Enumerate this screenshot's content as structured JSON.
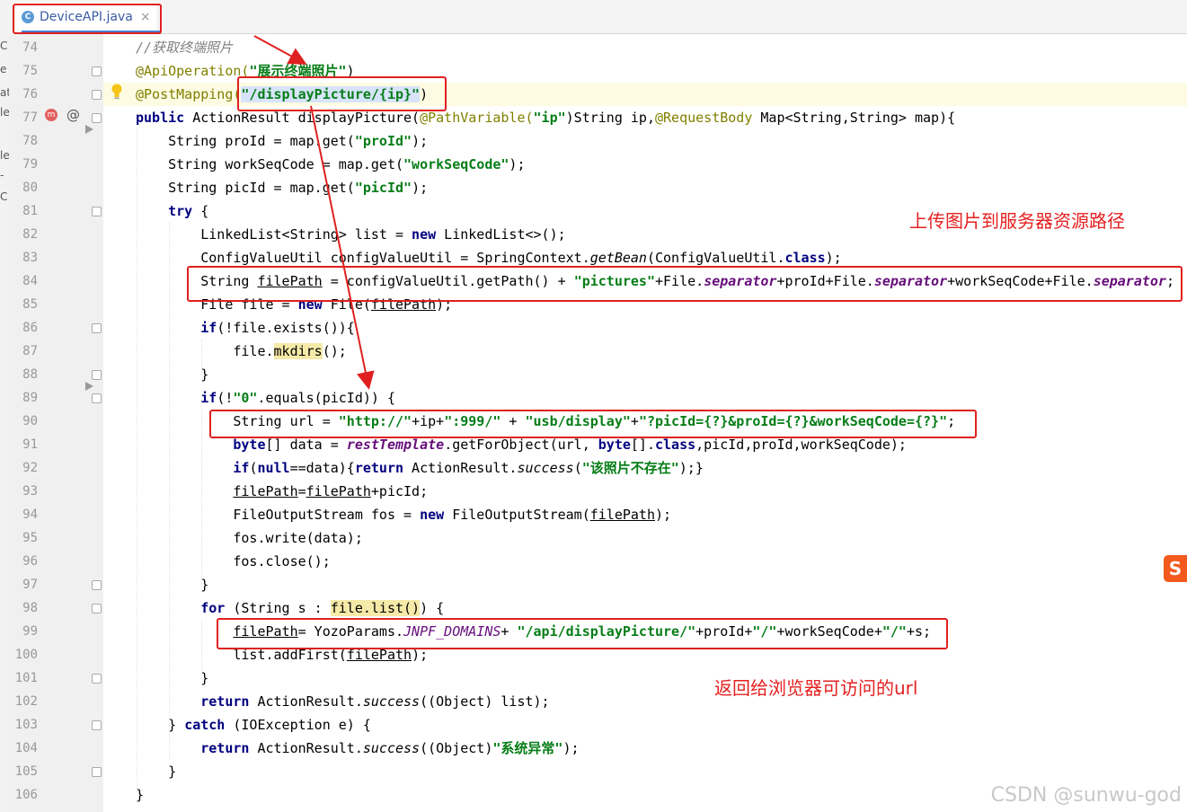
{
  "tab": {
    "filename": "DeviceAPI.java",
    "icon": "java-class-icon",
    "close": "×"
  },
  "left_strip": [
    "C",
    "e",
    "at",
    "le",
    "",
    "le",
    "-",
    "C"
  ],
  "annotations": {
    "upload_path_label": "上传图片到服务器资源路径",
    "return_url_label": "返回给浏览器可访问的url"
  },
  "watermark": "CSDN @sunwu-god",
  "input_method_icon": "S",
  "colors": {
    "red_box": "#e02020",
    "keyword": "#000080",
    "string": "#067d17",
    "annotation": "#808000"
  },
  "lines": [
    {
      "num": "74",
      "tokens": [
        {
          "t": "//获取终端照片",
          "c": "cm"
        }
      ]
    },
    {
      "num": "75",
      "tokens": [
        {
          "t": "@ApiOperation(",
          "c": "ann"
        },
        {
          "t": "\"展示终端照片\"",
          "c": "str"
        },
        {
          "t": ")",
          "c": ""
        }
      ]
    },
    {
      "num": "76",
      "tokens": [
        {
          "t": "@PostMapping(",
          "c": "ann"
        },
        {
          "t": "\"/displayPicture/{ip}\"",
          "c": "str sel"
        },
        {
          "t": ")",
          "c": ""
        }
      ]
    },
    {
      "num": "77",
      "tokens": [
        {
          "t": "public",
          "c": "kw"
        },
        {
          "t": " ActionResult displayPicture(",
          "c": ""
        },
        {
          "t": "@PathVariable(",
          "c": "ann"
        },
        {
          "t": "\"ip\"",
          "c": "str"
        },
        {
          "t": ")String ip,",
          "c": ""
        },
        {
          "t": "@RequestBody",
          "c": "ann"
        },
        {
          "t": " Map<String,String> map){",
          "c": ""
        }
      ]
    },
    {
      "num": "78",
      "tokens": [
        {
          "t": "    String proId = map.get(",
          "c": ""
        },
        {
          "t": "\"proId\"",
          "c": "str"
        },
        {
          "t": ");",
          "c": ""
        }
      ]
    },
    {
      "num": "79",
      "tokens": [
        {
          "t": "    String workSeqCode = map.get(",
          "c": ""
        },
        {
          "t": "\"workSeqCode\"",
          "c": "str"
        },
        {
          "t": ");",
          "c": ""
        }
      ]
    },
    {
      "num": "80",
      "tokens": [
        {
          "t": "    String picId = map.get(",
          "c": ""
        },
        {
          "t": "\"picId\"",
          "c": "str"
        },
        {
          "t": ");",
          "c": ""
        }
      ]
    },
    {
      "num": "81",
      "tokens": [
        {
          "t": "    ",
          "c": ""
        },
        {
          "t": "try",
          "c": "kw"
        },
        {
          "t": " {",
          "c": ""
        }
      ]
    },
    {
      "num": "82",
      "tokens": [
        {
          "t": "        LinkedList<String> list = ",
          "c": ""
        },
        {
          "t": "new",
          "c": "kw"
        },
        {
          "t": " LinkedList<>();",
          "c": ""
        }
      ]
    },
    {
      "num": "83",
      "tokens": [
        {
          "t": "        ConfigValueUtil configValueUtil = SpringContext.",
          "c": ""
        },
        {
          "t": "getBean",
          "c": "it"
        },
        {
          "t": "(ConfigValueUtil.",
          "c": ""
        },
        {
          "t": "class",
          "c": "kw"
        },
        {
          "t": ");",
          "c": ""
        }
      ]
    },
    {
      "num": "84",
      "tokens": [
        {
          "t": "        String ",
          "c": ""
        },
        {
          "t": "filePath",
          "c": "u"
        },
        {
          "t": " = configValueUtil.getPath() + ",
          "c": ""
        },
        {
          "t": "\"pictures\"",
          "c": "str"
        },
        {
          "t": "+File.",
          "c": ""
        },
        {
          "t": "separator",
          "c": "fld"
        },
        {
          "t": "+proId+File.",
          "c": ""
        },
        {
          "t": "separator",
          "c": "fld"
        },
        {
          "t": "+workSeqCode+File.",
          "c": ""
        },
        {
          "t": "separator",
          "c": "fld"
        },
        {
          "t": ";",
          "c": ""
        }
      ]
    },
    {
      "num": "85",
      "tokens": [
        {
          "t": "        File file = ",
          "c": ""
        },
        {
          "t": "new",
          "c": "kw"
        },
        {
          "t": " File(",
          "c": ""
        },
        {
          "t": "filePath",
          "c": "u"
        },
        {
          "t": ");",
          "c": ""
        }
      ]
    },
    {
      "num": "86",
      "tokens": [
        {
          "t": "        ",
          "c": ""
        },
        {
          "t": "if",
          "c": "kw"
        },
        {
          "t": "(!file.exists()){",
          "c": ""
        }
      ]
    },
    {
      "num": "87",
      "tokens": [
        {
          "t": "            file.",
          "c": ""
        },
        {
          "t": "mkdirs",
          "c": "hlw"
        },
        {
          "t": "();",
          "c": ""
        }
      ]
    },
    {
      "num": "88",
      "tokens": [
        {
          "t": "        }",
          "c": ""
        }
      ]
    },
    {
      "num": "89",
      "tokens": [
        {
          "t": "        ",
          "c": ""
        },
        {
          "t": "if",
          "c": "kw"
        },
        {
          "t": "(!",
          "c": ""
        },
        {
          "t": "\"0\"",
          "c": "str"
        },
        {
          "t": ".equals(picId)) {",
          "c": ""
        }
      ]
    },
    {
      "num": "90",
      "tokens": [
        {
          "t": "            String url = ",
          "c": ""
        },
        {
          "t": "\"http://\"",
          "c": "str"
        },
        {
          "t": "+ip+",
          "c": ""
        },
        {
          "t": "\":999/\"",
          "c": "str"
        },
        {
          "t": " + ",
          "c": ""
        },
        {
          "t": "\"usb/display\"",
          "c": "str"
        },
        {
          "t": "+",
          "c": ""
        },
        {
          "t": "\"?picId={?}&proId={?}&workSeqCode={?}\"",
          "c": "str"
        },
        {
          "t": ";",
          "c": ""
        }
      ]
    },
    {
      "num": "91",
      "tokens": [
        {
          "t": "            ",
          "c": ""
        },
        {
          "t": "byte",
          "c": "kw"
        },
        {
          "t": "[] data = ",
          "c": ""
        },
        {
          "t": "restTemplate",
          "c": "fld"
        },
        {
          "t": ".getForObject(url, ",
          "c": ""
        },
        {
          "t": "byte",
          "c": "kw"
        },
        {
          "t": "[].",
          "c": ""
        },
        {
          "t": "class",
          "c": "kw"
        },
        {
          "t": ",picId,proId,workSeqCode);",
          "c": ""
        }
      ]
    },
    {
      "num": "92",
      "tokens": [
        {
          "t": "            ",
          "c": ""
        },
        {
          "t": "if",
          "c": "kw"
        },
        {
          "t": "(",
          "c": ""
        },
        {
          "t": "null",
          "c": "kw"
        },
        {
          "t": "==data){",
          "c": ""
        },
        {
          "t": "return",
          "c": "kw"
        },
        {
          "t": " ActionResult.",
          "c": ""
        },
        {
          "t": "success",
          "c": "it"
        },
        {
          "t": "(",
          "c": ""
        },
        {
          "t": "\"该照片不存在\"",
          "c": "str"
        },
        {
          "t": ");}",
          "c": ""
        }
      ]
    },
    {
      "num": "93",
      "tokens": [
        {
          "t": "            ",
          "c": ""
        },
        {
          "t": "filePath",
          "c": "u"
        },
        {
          "t": "=",
          "c": ""
        },
        {
          "t": "filePath",
          "c": "u"
        },
        {
          "t": "+picId;",
          "c": ""
        }
      ]
    },
    {
      "num": "94",
      "tokens": [
        {
          "t": "            FileOutputStream fos = ",
          "c": ""
        },
        {
          "t": "new",
          "c": "kw"
        },
        {
          "t": " FileOutputStream(",
          "c": ""
        },
        {
          "t": "filePath",
          "c": "u"
        },
        {
          "t": ");",
          "c": ""
        }
      ]
    },
    {
      "num": "95",
      "tokens": [
        {
          "t": "            fos.write(data);",
          "c": ""
        }
      ]
    },
    {
      "num": "96",
      "tokens": [
        {
          "t": "            fos.close();",
          "c": ""
        }
      ]
    },
    {
      "num": "97",
      "tokens": [
        {
          "t": "        }",
          "c": ""
        }
      ]
    },
    {
      "num": "98",
      "tokens": [
        {
          "t": "        ",
          "c": ""
        },
        {
          "t": "for",
          "c": "kw"
        },
        {
          "t": " (String s : ",
          "c": ""
        },
        {
          "t": "file.list()",
          "c": "hlw"
        },
        {
          "t": ") {",
          "c": ""
        }
      ]
    },
    {
      "num": "99",
      "tokens": [
        {
          "t": "            ",
          "c": ""
        },
        {
          "t": "filePath",
          "c": "u"
        },
        {
          "t": "= YozoParams.",
          "c": ""
        },
        {
          "t": "JNPF_DOMAINS",
          "c": "fldi"
        },
        {
          "t": "+ ",
          "c": ""
        },
        {
          "t": "\"/api/displayPicture/\"",
          "c": "str"
        },
        {
          "t": "+proId+",
          "c": ""
        },
        {
          "t": "\"/\"",
          "c": "str"
        },
        {
          "t": "+workSeqCode+",
          "c": ""
        },
        {
          "t": "\"/\"",
          "c": "str"
        },
        {
          "t": "+s;",
          "c": ""
        }
      ]
    },
    {
      "num": "100",
      "tokens": [
        {
          "t": "            list.addFirst(",
          "c": ""
        },
        {
          "t": "filePath",
          "c": "u"
        },
        {
          "t": ");",
          "c": ""
        }
      ]
    },
    {
      "num": "101",
      "tokens": [
        {
          "t": "        }",
          "c": ""
        }
      ]
    },
    {
      "num": "102",
      "tokens": [
        {
          "t": "        ",
          "c": ""
        },
        {
          "t": "return",
          "c": "kw"
        },
        {
          "t": " ActionResult.",
          "c": ""
        },
        {
          "t": "success",
          "c": "it"
        },
        {
          "t": "((Object) list);",
          "c": ""
        }
      ]
    },
    {
      "num": "103",
      "tokens": [
        {
          "t": "    } ",
          "c": ""
        },
        {
          "t": "catch",
          "c": "kw"
        },
        {
          "t": " (IOException e) {",
          "c": ""
        }
      ]
    },
    {
      "num": "104",
      "tokens": [
        {
          "t": "        ",
          "c": ""
        },
        {
          "t": "return",
          "c": "kw"
        },
        {
          "t": " ActionResult.",
          "c": ""
        },
        {
          "t": "success",
          "c": "it"
        },
        {
          "t": "((Object)",
          "c": ""
        },
        {
          "t": "\"系统异常\"",
          "c": "str"
        },
        {
          "t": ");",
          "c": ""
        }
      ]
    },
    {
      "num": "105",
      "tokens": [
        {
          "t": "    }",
          "c": ""
        }
      ]
    },
    {
      "num": "106",
      "tokens": [
        {
          "t": "}",
          "c": ""
        }
      ]
    }
  ]
}
